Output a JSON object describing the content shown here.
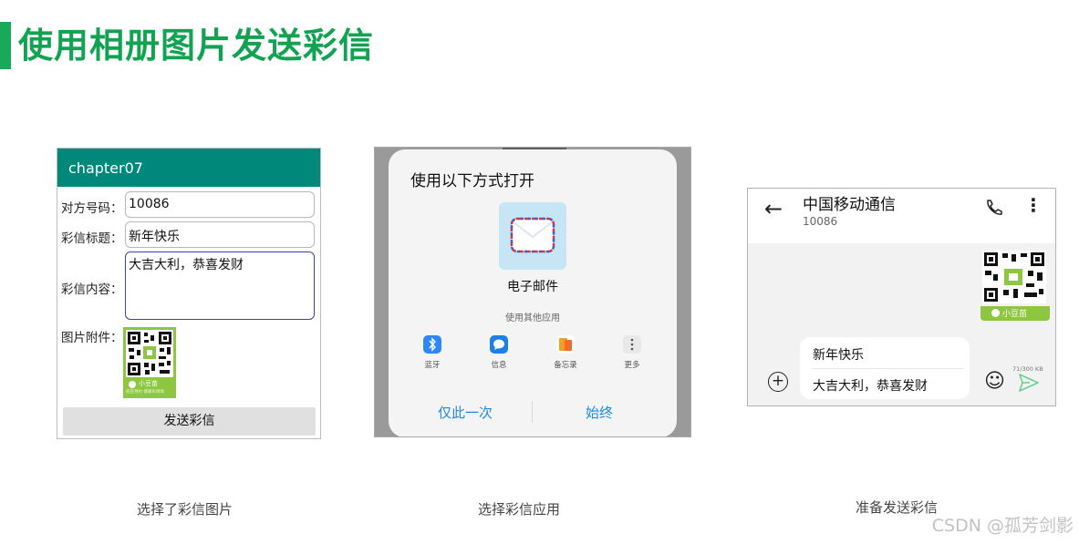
{
  "slide": {
    "title": "使用相册图片发送彩信",
    "watermark": "CSDN @孤芳剑影"
  },
  "captions": [
    "选择了彩信图片",
    "选择彩信应用",
    "准备发送彩信"
  ],
  "panel1": {
    "app_title": "chapter07",
    "fields": [
      {
        "label": "对方号码：",
        "value": "10086"
      },
      {
        "label": "彩信标题：",
        "value": "新年快乐"
      },
      {
        "label": "彩信内容：",
        "value": "大吉大利，恭喜发财"
      }
    ],
    "attachment_label": "图片附件：",
    "qr_brand": "小豆苗",
    "qr_slogan": "疫苗预约 健康有保障",
    "send_label": "发送彩信"
  },
  "panel2": {
    "heading": "使用以下方式打开",
    "primary_app": {
      "label": "电子邮件",
      "icon": "mail-envelope-icon"
    },
    "other_label": "使用其他应用",
    "apps": [
      {
        "label": "蓝牙",
        "icon": "bluetooth-icon",
        "color": "#2f86f6"
      },
      {
        "label": "信息",
        "icon": "messages-icon",
        "color": "#1e7fe8"
      },
      {
        "label": "备忘录",
        "icon": "notes-icon",
        "color": "#f0a020"
      },
      {
        "label": "更多",
        "icon": "more-icon",
        "color": "#e8e8e8"
      }
    ],
    "buttons": {
      "once": "仅此一次",
      "always": "始终"
    }
  },
  "panel3": {
    "contact_name": "中国移动通信",
    "contact_number": "10086",
    "attachment_brand": "小豆苗",
    "compose": {
      "subject": "新年快乐",
      "body": "大吉大利，恭喜发财"
    },
    "size_indicator": "71/300 KB"
  },
  "colors": {
    "title_green": "#11a352",
    "app_bar": "#00897b",
    "brand_green": "#8dc63f",
    "link_blue": "#1d88e5"
  }
}
